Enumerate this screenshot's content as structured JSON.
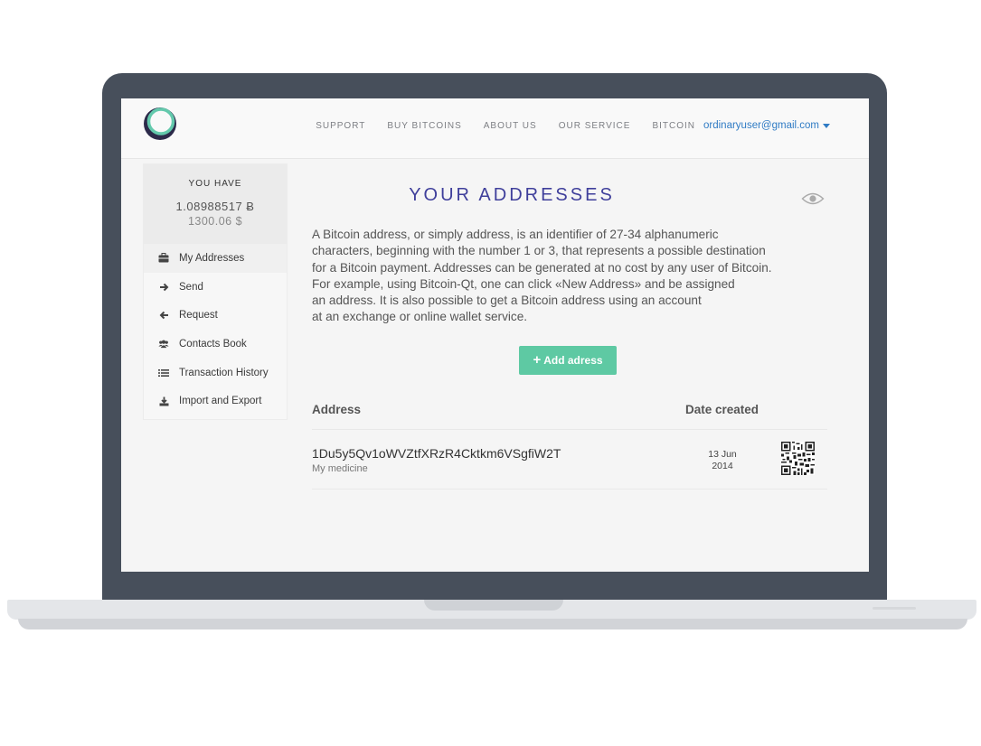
{
  "header": {
    "nav": [
      "SUPPORT",
      "BUY BITCOINS",
      "ABOUT US",
      "OUR SERVICE",
      "BITCOIN"
    ],
    "user_email": "ordinaryuser@gmail.com"
  },
  "balance": {
    "label": "YOU HAVE",
    "btc": "1.08988517 Ƀ",
    "usd": "1300.06 $"
  },
  "sidebar": {
    "items": [
      {
        "label": "My Addresses",
        "icon": "briefcase-icon",
        "active": true
      },
      {
        "label": "Send",
        "icon": "arrow-right-icon"
      },
      {
        "label": "Request",
        "icon": "arrow-left-icon"
      },
      {
        "label": "Contacts Book",
        "icon": "users-icon"
      },
      {
        "label": "Transaction History",
        "icon": "list-icon"
      },
      {
        "label": "Import and Export",
        "icon": "download-icon"
      }
    ]
  },
  "main": {
    "title": "YOUR ADDRESSES",
    "description_lines": [
      "A Bitcoin address, or simply address, is an identifier of 27-34 alphanumeric",
      "characters, beginning with the number 1 or 3, that represents a possible destination",
      "for a Bitcoin payment. Addresses can be generated at no cost by any user of Bitcoin.",
      "For example, using Bitcoin-Qt, one can click «New Address» and be assigned",
      "an address. It is also possible to get a Bitcoin address using an account",
      "at an exchange or online wallet service."
    ],
    "add_button": "Add adress",
    "table": {
      "col_address": "Address",
      "col_date": "Date created",
      "rows": [
        {
          "address": "1Du5y5Qv1oWVZtfXRzR4Cktkm6VSgfiW2T",
          "note": "My medicine",
          "date_day": "13 Jun",
          "date_year": "2014"
        }
      ]
    }
  },
  "colors": {
    "accent": "#5ec9a3",
    "title": "#3f3f9b",
    "link": "#2f7bc4",
    "bezel": "#474f5b"
  }
}
